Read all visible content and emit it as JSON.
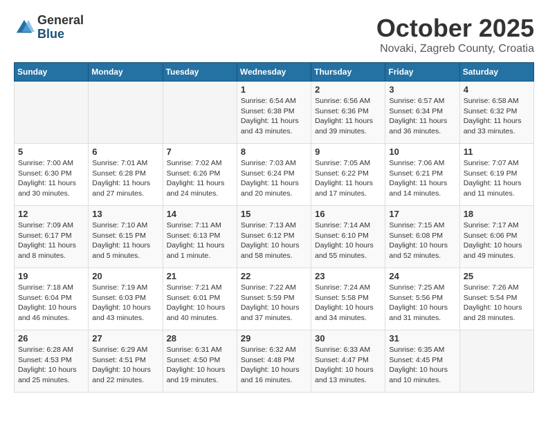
{
  "logo": {
    "line1": "General",
    "line2": "Blue"
  },
  "title": "October 2025",
  "subtitle": "Novaki, Zagreb County, Croatia",
  "days_header": [
    "Sunday",
    "Monday",
    "Tuesday",
    "Wednesday",
    "Thursday",
    "Friday",
    "Saturday"
  ],
  "weeks": [
    [
      {
        "day": "",
        "info": ""
      },
      {
        "day": "",
        "info": ""
      },
      {
        "day": "",
        "info": ""
      },
      {
        "day": "1",
        "info": "Sunrise: 6:54 AM\nSunset: 6:38 PM\nDaylight: 11 hours and 43 minutes."
      },
      {
        "day": "2",
        "info": "Sunrise: 6:56 AM\nSunset: 6:36 PM\nDaylight: 11 hours and 39 minutes."
      },
      {
        "day": "3",
        "info": "Sunrise: 6:57 AM\nSunset: 6:34 PM\nDaylight: 11 hours and 36 minutes."
      },
      {
        "day": "4",
        "info": "Sunrise: 6:58 AM\nSunset: 6:32 PM\nDaylight: 11 hours and 33 minutes."
      }
    ],
    [
      {
        "day": "5",
        "info": "Sunrise: 7:00 AM\nSunset: 6:30 PM\nDaylight: 11 hours and 30 minutes."
      },
      {
        "day": "6",
        "info": "Sunrise: 7:01 AM\nSunset: 6:28 PM\nDaylight: 11 hours and 27 minutes."
      },
      {
        "day": "7",
        "info": "Sunrise: 7:02 AM\nSunset: 6:26 PM\nDaylight: 11 hours and 24 minutes."
      },
      {
        "day": "8",
        "info": "Sunrise: 7:03 AM\nSunset: 6:24 PM\nDaylight: 11 hours and 20 minutes."
      },
      {
        "day": "9",
        "info": "Sunrise: 7:05 AM\nSunset: 6:22 PM\nDaylight: 11 hours and 17 minutes."
      },
      {
        "day": "10",
        "info": "Sunrise: 7:06 AM\nSunset: 6:21 PM\nDaylight: 11 hours and 14 minutes."
      },
      {
        "day": "11",
        "info": "Sunrise: 7:07 AM\nSunset: 6:19 PM\nDaylight: 11 hours and 11 minutes."
      }
    ],
    [
      {
        "day": "12",
        "info": "Sunrise: 7:09 AM\nSunset: 6:17 PM\nDaylight: 11 hours and 8 minutes."
      },
      {
        "day": "13",
        "info": "Sunrise: 7:10 AM\nSunset: 6:15 PM\nDaylight: 11 hours and 5 minutes."
      },
      {
        "day": "14",
        "info": "Sunrise: 7:11 AM\nSunset: 6:13 PM\nDaylight: 11 hours and 1 minute."
      },
      {
        "day": "15",
        "info": "Sunrise: 7:13 AM\nSunset: 6:12 PM\nDaylight: 10 hours and 58 minutes."
      },
      {
        "day": "16",
        "info": "Sunrise: 7:14 AM\nSunset: 6:10 PM\nDaylight: 10 hours and 55 minutes."
      },
      {
        "day": "17",
        "info": "Sunrise: 7:15 AM\nSunset: 6:08 PM\nDaylight: 10 hours and 52 minutes."
      },
      {
        "day": "18",
        "info": "Sunrise: 7:17 AM\nSunset: 6:06 PM\nDaylight: 10 hours and 49 minutes."
      }
    ],
    [
      {
        "day": "19",
        "info": "Sunrise: 7:18 AM\nSunset: 6:04 PM\nDaylight: 10 hours and 46 minutes."
      },
      {
        "day": "20",
        "info": "Sunrise: 7:19 AM\nSunset: 6:03 PM\nDaylight: 10 hours and 43 minutes."
      },
      {
        "day": "21",
        "info": "Sunrise: 7:21 AM\nSunset: 6:01 PM\nDaylight: 10 hours and 40 minutes."
      },
      {
        "day": "22",
        "info": "Sunrise: 7:22 AM\nSunset: 5:59 PM\nDaylight: 10 hours and 37 minutes."
      },
      {
        "day": "23",
        "info": "Sunrise: 7:24 AM\nSunset: 5:58 PM\nDaylight: 10 hours and 34 minutes."
      },
      {
        "day": "24",
        "info": "Sunrise: 7:25 AM\nSunset: 5:56 PM\nDaylight: 10 hours and 31 minutes."
      },
      {
        "day": "25",
        "info": "Sunrise: 7:26 AM\nSunset: 5:54 PM\nDaylight: 10 hours and 28 minutes."
      }
    ],
    [
      {
        "day": "26",
        "info": "Sunrise: 6:28 AM\nSunset: 4:53 PM\nDaylight: 10 hours and 25 minutes."
      },
      {
        "day": "27",
        "info": "Sunrise: 6:29 AM\nSunset: 4:51 PM\nDaylight: 10 hours and 22 minutes."
      },
      {
        "day": "28",
        "info": "Sunrise: 6:31 AM\nSunset: 4:50 PM\nDaylight: 10 hours and 19 minutes."
      },
      {
        "day": "29",
        "info": "Sunrise: 6:32 AM\nSunset: 4:48 PM\nDaylight: 10 hours and 16 minutes."
      },
      {
        "day": "30",
        "info": "Sunrise: 6:33 AM\nSunset: 4:47 PM\nDaylight: 10 hours and 13 minutes."
      },
      {
        "day": "31",
        "info": "Sunrise: 6:35 AM\nSunset: 4:45 PM\nDaylight: 10 hours and 10 minutes."
      },
      {
        "day": "",
        "info": ""
      }
    ]
  ]
}
